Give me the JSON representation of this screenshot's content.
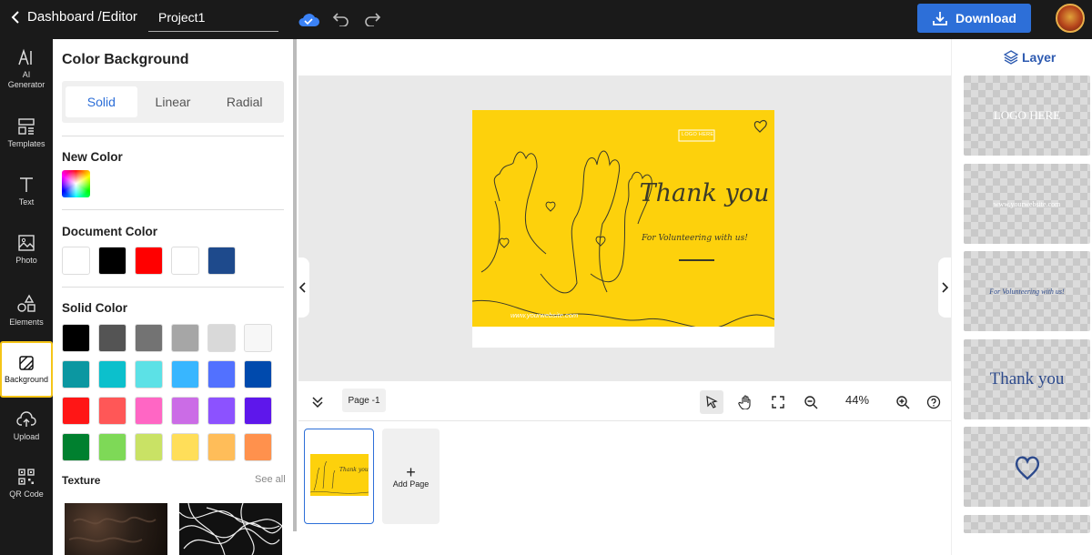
{
  "topbar": {
    "breadcrumb": "Dashboard /Editor",
    "project_name": "Project1",
    "download_label": "Download"
  },
  "nav": [
    {
      "label": "AI Generator",
      "icon": "ai-icon"
    },
    {
      "label": "Templates",
      "icon": "templates-icon"
    },
    {
      "label": "Text",
      "icon": "text-icon"
    },
    {
      "label": "Photo",
      "icon": "photo-icon"
    },
    {
      "label": "Elements",
      "icon": "elements-icon"
    },
    {
      "label": "Background",
      "icon": "background-icon",
      "active": true
    },
    {
      "label": "Upload",
      "icon": "upload-icon"
    },
    {
      "label": "QR Code",
      "icon": "qr-code-icon"
    }
  ],
  "panel": {
    "title": "Color Background",
    "tabs": [
      "Solid",
      "Linear",
      "Radial"
    ],
    "selected_tab": "Solid",
    "new_color_label": "New Color",
    "document_color_label": "Document Color",
    "document_colors": [
      "#ffffff",
      "#000000",
      "#ff0000",
      "#ffffff",
      "#1e4a8c"
    ],
    "solid_color_label": "Solid Color",
    "solid_colors": [
      [
        "#000000",
        "#545454",
        "#737373",
        "#a6a6a6",
        "#d9d9d9",
        "#f7f7f7"
      ],
      [
        "#0c97a1",
        "#0cc0cc",
        "#5ce1e6",
        "#38b6ff",
        "#5271ff",
        "#004aad"
      ],
      [
        "#ff1616",
        "#ff5757",
        "#ff66c4",
        "#cb6ce6",
        "#8c52ff",
        "#5e17eb"
      ],
      [
        "#00802f",
        "#7ed957",
        "#c9e265",
        "#ffde59",
        "#ffbd59",
        "#ff914d"
      ]
    ],
    "texture_label": "Texture",
    "see_all": "See all"
  },
  "design": {
    "logo": "LOGO HERE",
    "title": "Thank you",
    "subtitle": "For Volunteering with us!",
    "website": "www.yourwebsite.com"
  },
  "bottombar": {
    "page_label": "Page -1",
    "zoom": "44%",
    "add_page": "Add Page"
  },
  "layers": {
    "title": "Layer",
    "items": [
      "LOGO HERE",
      "www.yourwebsite.com",
      "For Volunteering with us!",
      "Thank you"
    ]
  },
  "colors": {
    "accent": "#2d6fd8",
    "topbar": "#1a1a1a",
    "design_bg": "#fdd10c",
    "active_nav_border": "#f5c518"
  }
}
